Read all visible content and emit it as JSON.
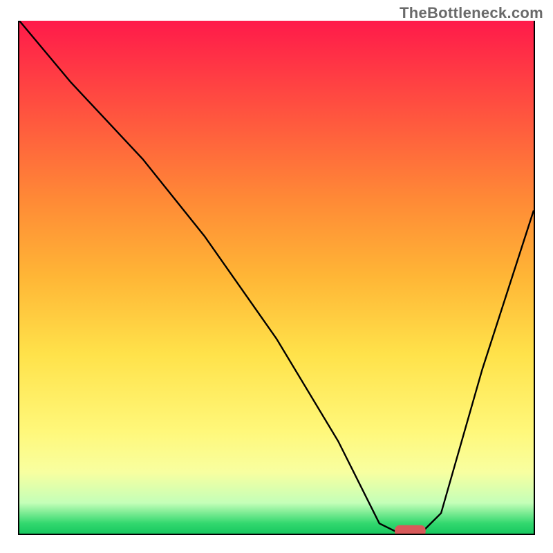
{
  "watermark": "TheBottleneck.com",
  "chart_data": {
    "type": "line",
    "title": "",
    "xlabel": "",
    "ylabel": "",
    "xlim": [
      0,
      100
    ],
    "ylim": [
      0,
      100
    ],
    "background_gradient": {
      "top": "#ff1a4a",
      "mid_upper": "#ff8a36",
      "mid": "#ffe24a",
      "mid_lower": "#fff87a",
      "bottom": "#18c860"
    },
    "series": [
      {
        "name": "bottleneck-curve",
        "color": "#000000",
        "x": [
          0,
          10,
          24,
          36,
          50,
          62,
          70,
          74,
          78,
          82,
          90,
          100
        ],
        "y": [
          100,
          88,
          73,
          58,
          38,
          18,
          2,
          0,
          0,
          4,
          32,
          63
        ]
      }
    ],
    "marker": {
      "name": "optimal-marker",
      "shape": "pill",
      "color": "#d85a5a",
      "x": 76,
      "y": 0,
      "width": 6,
      "height": 2.2
    }
  }
}
